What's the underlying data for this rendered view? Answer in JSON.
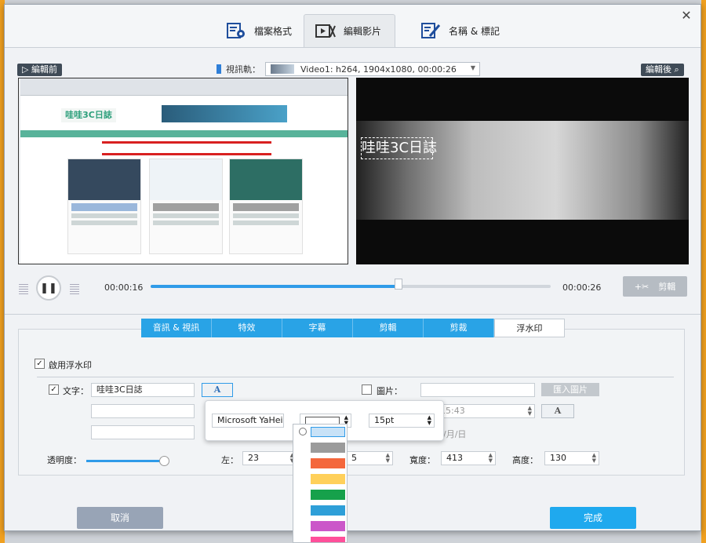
{
  "tabs": [
    {
      "label": "檔案格式",
      "icon": "file-format-icon"
    },
    {
      "label": "編輯影片",
      "icon": "edit-video-icon"
    },
    {
      "label": "名稱 & 標記",
      "icon": "rename-tag-icon"
    }
  ],
  "preview": {
    "before_label": "編輯前",
    "after_label": "編輯後",
    "track_label": "視訊軌：",
    "track_value": "Video1: h264, 1904x1080, 00:00:26",
    "site_logo": "哇哇3C日誌",
    "watermark_text": "哇哇3C日誌"
  },
  "player": {
    "current_time": "00:00:16",
    "end_time": "00:00:26",
    "progress": 0.62,
    "cut_label": "剪輯"
  },
  "subtabs": [
    "音訊 & 視訊",
    "特效",
    "字幕",
    "剪輯",
    "剪裁",
    "浮水印"
  ],
  "watermark": {
    "enable_label": "啟用浮水印",
    "text_label": "文字：",
    "text_value": "哇哇3C日誌",
    "font_button": "A",
    "image_label": "圖片：",
    "import_label": "匯入圖片",
    "time_value": "15:43",
    "date_format": "年/月/日",
    "opacity_label": "透明度：",
    "opacity": 1.0,
    "left_label": "左：",
    "left_value": "23",
    "top_value": "5",
    "width_label": "寬度：",
    "width_value": "413",
    "height_label": "高度：",
    "height_value": "130"
  },
  "font_popup": {
    "font": "Microsoft YaHei",
    "size": "15pt"
  },
  "color_swatches": [
    "#c8e2f7",
    "#9b9b9b",
    "#f4673c",
    "#ffd05a",
    "#16a14b",
    "#2e9fd8",
    "#cb57c9",
    "#ff4f9a"
  ],
  "footer": {
    "cancel": "取消",
    "done": "完成"
  }
}
